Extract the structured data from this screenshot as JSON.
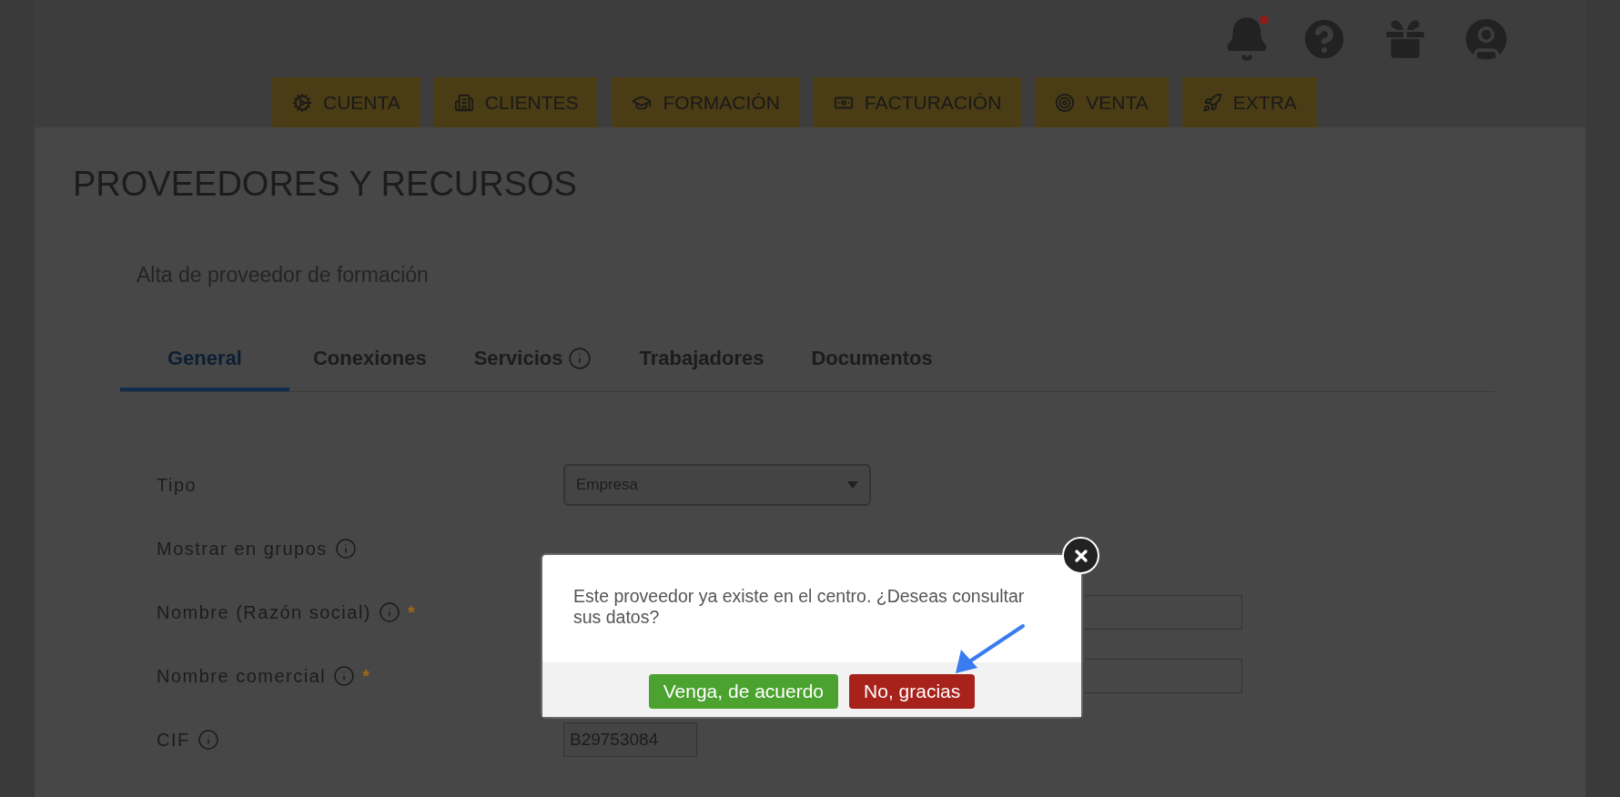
{
  "header": {
    "has_notification": true
  },
  "nav": [
    {
      "label": "CUENTA"
    },
    {
      "label": "CLIENTES"
    },
    {
      "label": "FORMACIÓN"
    },
    {
      "label": "FACTURACIÓN"
    },
    {
      "label": "VENTA"
    },
    {
      "label": "EXTRA"
    }
  ],
  "page": {
    "title": "PROVEEDORES Y RECURSOS",
    "subtitle": "Alta de proveedor de formación"
  },
  "tabs": [
    {
      "label": "General",
      "selected": true,
      "info": false
    },
    {
      "label": "Conexiones",
      "selected": false,
      "info": false
    },
    {
      "label": "Servicios",
      "selected": false,
      "info": true
    },
    {
      "label": "Trabajadores",
      "selected": false,
      "info": false
    },
    {
      "label": "Documentos",
      "selected": false,
      "info": false
    }
  ],
  "form": {
    "fields": [
      {
        "label": "Tipo",
        "kind": "select",
        "value": "Empresa",
        "info": false
      },
      {
        "label": "Mostrar en grupos",
        "kind": "hidden",
        "info": true
      },
      {
        "label": "Nombre (Razón social)",
        "kind": "text",
        "info": true,
        "required_mark": "*"
      },
      {
        "label": "Nombre comercial",
        "kind": "text",
        "info": true,
        "required_mark": "*"
      },
      {
        "label": "CIF",
        "kind": "short",
        "value": "B29753084",
        "info": true
      }
    ]
  },
  "dialog": {
    "message": "Este proveedor ya existe en el centro. ¿Deseas consultar sus datos?",
    "buttons": [
      {
        "label": "Venga, de acuerdo",
        "kind": "confirm"
      },
      {
        "label": "No, gracias",
        "kind": "cancel"
      }
    ]
  }
}
